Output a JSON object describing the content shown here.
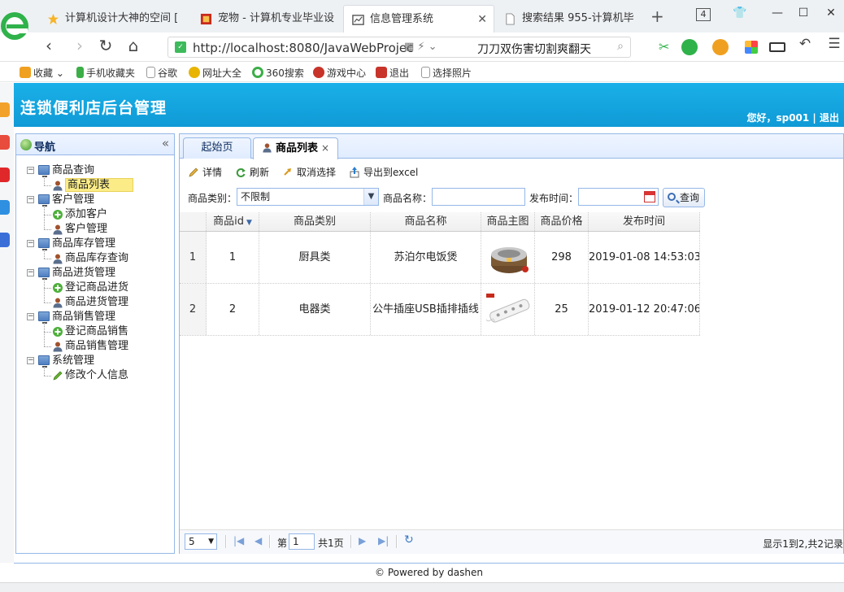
{
  "browser": {
    "tabs": [
      {
        "title": "计算机设计大神的空间 [",
        "icon_color": "#f6b428"
      },
      {
        "title": "宠物 - 计算机专业毕业设",
        "icon_color": "#c82a1c"
      },
      {
        "title": "信息管理系统",
        "icon_color": "#6a6a6a"
      },
      {
        "title": "搜索结果 955-计算机毕",
        "icon_color": "#888888"
      }
    ],
    "tab_count": "4",
    "new_tab_glyph": "+",
    "url": "http://localhost:8080/JavaWebProjec",
    "search_text": "刀刀双伤害切割爽翻天",
    "bookmarks": [
      {
        "label": "收藏",
        "color": "#f0a020"
      },
      {
        "label": "手机收藏夹",
        "color": "#3cae48"
      },
      {
        "label": "谷歌",
        "color": "#9a9a9a"
      },
      {
        "label": "网址大全",
        "color": "#e8b400"
      },
      {
        "label": "360搜索",
        "color": "#3cae48"
      },
      {
        "label": "游戏中心",
        "color": "#c8342a"
      },
      {
        "label": "退出",
        "color": "#c8342a"
      },
      {
        "label": "选择照片",
        "color": "#9a9a9a"
      }
    ]
  },
  "app": {
    "title": "连锁便利店后台管理",
    "user_info": "您好，sp001 | 退出",
    "header_color": "#14a6e0",
    "footer": "© Powered by dashen"
  },
  "nav": {
    "title": "导航",
    "collapse_glyph": "«",
    "groups": [
      {
        "label": "商品查询",
        "items": [
          {
            "label": "商品列表",
            "icon": "user-icon"
          }
        ]
      },
      {
        "label": "客户管理",
        "items": [
          {
            "label": "添加客户",
            "icon": "add-icon"
          },
          {
            "label": "客户管理",
            "icon": "user-icon"
          }
        ]
      },
      {
        "label": "商品库存管理",
        "items": [
          {
            "label": "商品库存查询",
            "icon": "user-icon"
          }
        ]
      },
      {
        "label": "商品进货管理",
        "items": [
          {
            "label": "登记商品进货",
            "icon": "add-icon"
          },
          {
            "label": "商品进货管理",
            "icon": "user-icon"
          }
        ]
      },
      {
        "label": "商品销售管理",
        "items": [
          {
            "label": "登记商品销售",
            "icon": "add-icon"
          },
          {
            "label": "商品销售管理",
            "icon": "user-icon"
          }
        ]
      },
      {
        "label": "系统管理",
        "items": [
          {
            "label": "修改个人信息",
            "icon": "pencil-icon"
          }
        ]
      }
    ]
  },
  "main": {
    "tabs": [
      {
        "label": "起始页"
      },
      {
        "label": "商品列表",
        "close": "×"
      }
    ],
    "toolbar": {
      "detail": "详情",
      "refresh": "刷新",
      "unselect": "取消选择",
      "export": "导出到excel"
    },
    "filter": {
      "category_label": "商品类别：",
      "category_value": "不限制",
      "name_label": "商品名称：",
      "name_value": "",
      "date_label": "发布时间：",
      "date_value": "",
      "query_button": "查询"
    },
    "grid": {
      "columns": [
        "商品id",
        "商品类别",
        "商品名称",
        "商品主图",
        "商品价格",
        "发布时间"
      ],
      "sort_glyph": "▼",
      "rows": [
        {
          "num": "1",
          "id": "1",
          "category": "厨具类",
          "name": "苏泊尔电饭煲",
          "price": "298",
          "time": "2019-01-08 14:53:03",
          "img": "rice-cooker"
        },
        {
          "num": "2",
          "id": "2",
          "category": "电器类",
          "name": "公牛插座USB插排插线",
          "price": "25",
          "time": "2019-01-12 20:47:06",
          "img": "power-strip"
        }
      ]
    },
    "pager": {
      "page_size": "5",
      "page_label": "第",
      "page_value": "1",
      "total_pages": "共1页",
      "info": "显示1到2,共2记录"
    }
  }
}
